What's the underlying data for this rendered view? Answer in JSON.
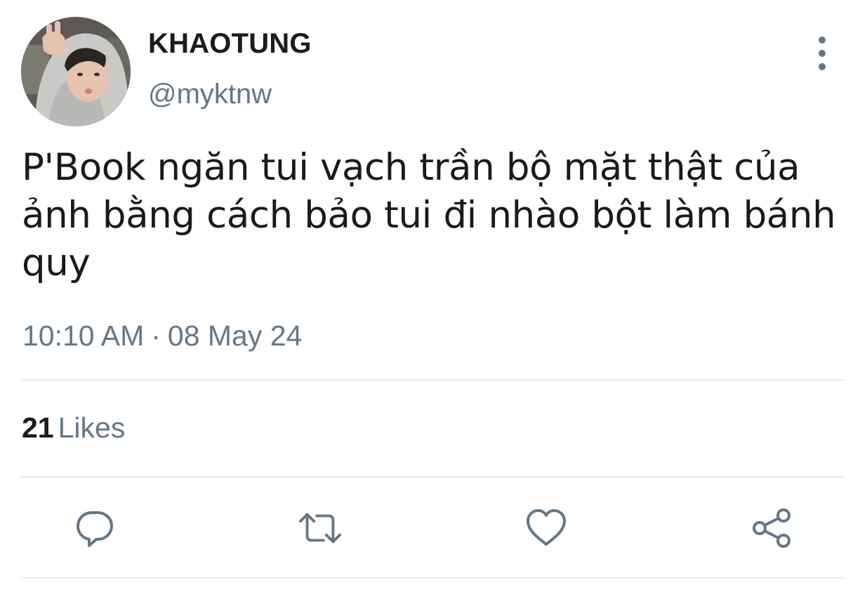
{
  "user": {
    "display_name": "KHAOTUNG",
    "handle": "@myktnw",
    "avatar_icon": "profile-photo"
  },
  "tweet": {
    "text": "P'Book ngăn tui vạch trần bộ mặt thật của ảnh bằng cách bảo tui đi nhào bột làm bánh quy",
    "time": "10:10 AM",
    "separator": "·",
    "date": "08 May 24"
  },
  "stats": {
    "likes_count": "21",
    "likes_label": "Likes"
  },
  "actions": [
    {
      "name": "reply",
      "icon": "reply-icon"
    },
    {
      "name": "retweet",
      "icon": "retweet-icon"
    },
    {
      "name": "like",
      "icon": "heart-icon"
    },
    {
      "name": "share",
      "icon": "share-icon"
    }
  ],
  "colors": {
    "secondary_text": "#657786",
    "primary_text": "#14171a",
    "divider": "#e6ecf0"
  }
}
